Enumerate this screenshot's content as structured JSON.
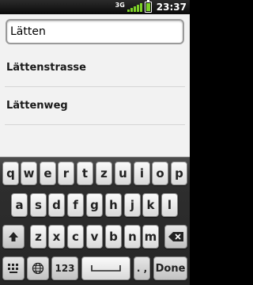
{
  "statusbar": {
    "network_type": "3G",
    "time": "23:37",
    "signal_icon": "signal-icon",
    "battery_icon": "battery-icon"
  },
  "search": {
    "value": "Lätten"
  },
  "suggestions": [
    {
      "label": "Lättenstrasse"
    },
    {
      "label": "Lättenweg"
    }
  ],
  "keyboard": {
    "row1": [
      "q",
      "w",
      "e",
      "r",
      "t",
      "z",
      "u",
      "i",
      "o",
      "p"
    ],
    "row2": [
      "a",
      "s",
      "d",
      "f",
      "g",
      "h",
      "j",
      "k",
      "l"
    ],
    "row3": [
      "z",
      "x",
      "c",
      "v",
      "b",
      "n",
      "m"
    ],
    "numbers_label": "123",
    "punct_label": ". ,",
    "done_label": "Done",
    "accent_color": "#7dd127"
  }
}
